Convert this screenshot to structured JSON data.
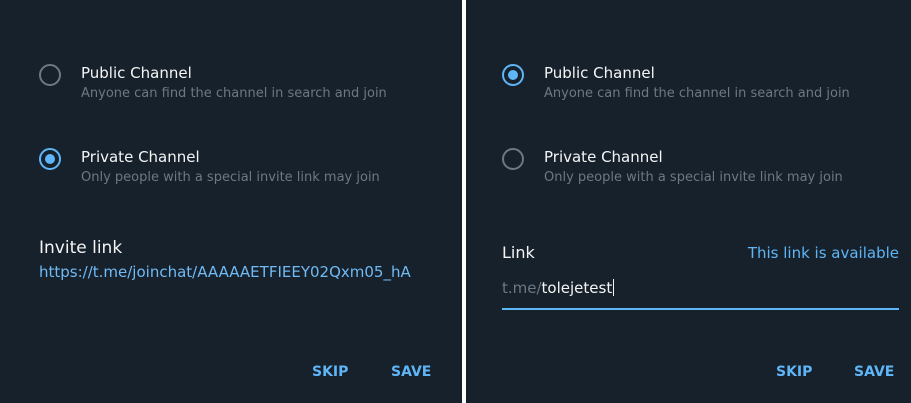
{
  "left": {
    "options": {
      "public": {
        "title": "Public Channel",
        "description": "Anyone can find the channel in search and join",
        "selected": false
      },
      "private": {
        "title": "Private Channel",
        "description": "Only people with a special invite link may join",
        "selected": true
      }
    },
    "invite_label": "Invite link",
    "invite_url": "https://t.me/joinchat/AAAAAETFIEEY02Qxm05_hA",
    "skip_label": "SKIP",
    "save_label": "SAVE"
  },
  "right": {
    "options": {
      "public": {
        "title": "Public Channel",
        "description": "Anyone can find the channel in search and join",
        "selected": true
      },
      "private": {
        "title": "Private Channel",
        "description": "Only people with a special invite link may join",
        "selected": false
      }
    },
    "link_label": "Link",
    "link_status": "This link is available",
    "link_prefix": "t.me/",
    "link_value": "tolejetest",
    "skip_label": "SKIP",
    "save_label": "SAVE"
  },
  "colors": {
    "background": "#17212b",
    "accent": "#5eb5f7",
    "link": "#70baf5",
    "text": "#f5f5f5",
    "muted": "#6c7883"
  }
}
